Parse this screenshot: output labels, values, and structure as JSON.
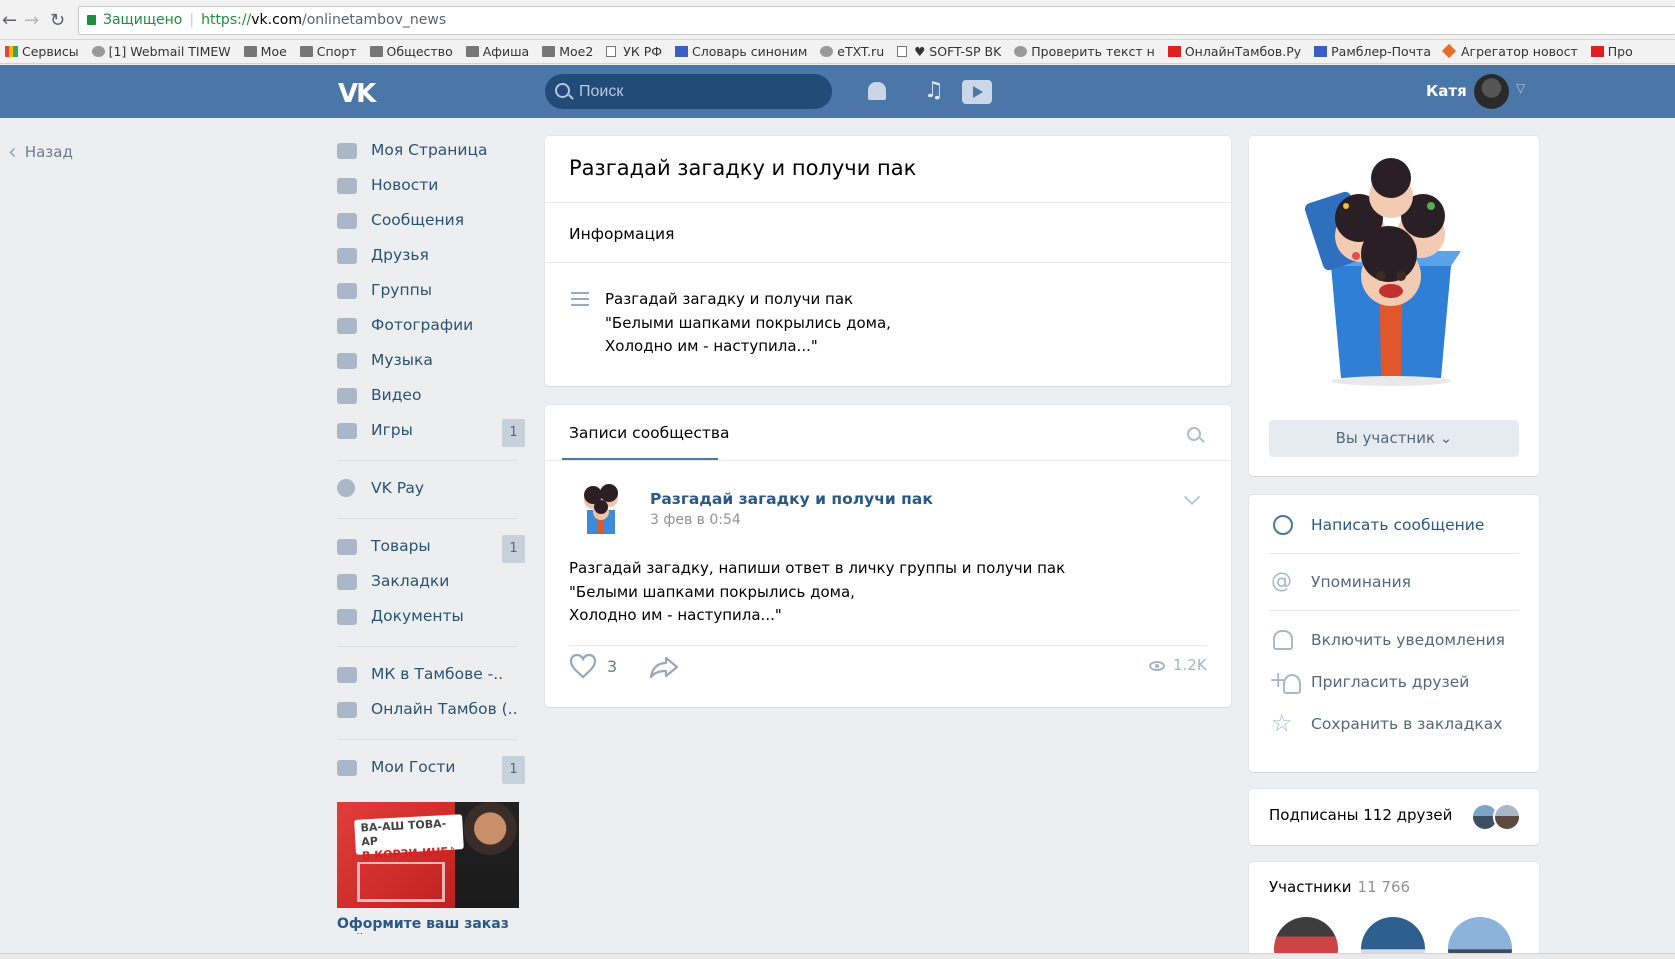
{
  "browser": {
    "secure_label": "Защищено",
    "url_scheme": "https://",
    "url_host": "vk.com",
    "url_path": "/onlinetambov_news",
    "bookmarks": [
      {
        "label": "Сервисы",
        "icon": "apps-icon"
      },
      {
        "label": "[1] Webmail TIMEW",
        "icon": "webmail-icon"
      },
      {
        "label": "Мое",
        "icon": "folder-icon"
      },
      {
        "label": "Спорт",
        "icon": "folder-icon"
      },
      {
        "label": "Общество",
        "icon": "folder-icon"
      },
      {
        "label": "Афиша",
        "icon": "folder-icon"
      },
      {
        "label": "Мое2",
        "icon": "folder-icon"
      },
      {
        "label": "УК РФ",
        "icon": "document-icon"
      },
      {
        "label": "Словарь синоним",
        "icon": "dictionary-icon"
      },
      {
        "label": "eTXT.ru",
        "icon": "etxt-icon"
      },
      {
        "label": "♥ SOFT-SP BK",
        "icon": "document-icon"
      },
      {
        "label": "Проверить текст н",
        "icon": "eye-icon"
      },
      {
        "label": "ОнлайнТамбов.Ру",
        "icon": "onlinetambov-icon"
      },
      {
        "label": "Рамблер-Почта",
        "icon": "mail-icon"
      },
      {
        "label": "Агрегатор новост",
        "icon": "aggregator-icon"
      },
      {
        "label": "Про",
        "icon": "copyright-icon"
      }
    ]
  },
  "header": {
    "logo": "VK",
    "search_placeholder": "Поиск",
    "user_name": "Катя",
    "music_glyph": "♫"
  },
  "back_label": "Назад",
  "menu": {
    "items": [
      {
        "label": "Моя Страница",
        "icon": "home-icon",
        "badge": ""
      },
      {
        "label": "Новости",
        "icon": "news-icon",
        "badge": ""
      },
      {
        "label": "Сообщения",
        "icon": "messages-icon",
        "badge": ""
      },
      {
        "label": "Друзья",
        "icon": "friends-icon",
        "badge": ""
      },
      {
        "label": "Группы",
        "icon": "groups-icon",
        "badge": ""
      },
      {
        "label": "Фотографии",
        "icon": "camera-icon",
        "badge": ""
      },
      {
        "label": "Музыка",
        "icon": "music-icon",
        "badge": ""
      },
      {
        "label": "Видео",
        "icon": "video-icon",
        "badge": ""
      },
      {
        "label": "Игры",
        "icon": "gamepad-icon",
        "badge": "1"
      }
    ],
    "vkpay": {
      "label": "VK Pay",
      "icon": "vkpay-icon"
    },
    "items2": [
      {
        "label": "Товары",
        "icon": "bag-icon",
        "badge": "1"
      },
      {
        "label": "Закладки",
        "icon": "star-icon",
        "badge": ""
      },
      {
        "label": "Документы",
        "icon": "document-icon",
        "badge": ""
      }
    ],
    "groups": [
      {
        "label": "МК в Тамбове -..",
        "icon": "groups-icon"
      },
      {
        "label": "Онлайн Тамбов (..",
        "icon": "groups-icon"
      }
    ],
    "guests": {
      "label": "Мои Гости",
      "icon": "apps-icon",
      "badge": "1"
    },
    "ad": {
      "tag_line1": "ВА-АШ ТОВА-АР",
      "tag_line2": "В КОРЗИ-ИНЕ♪",
      "caption": "Оформите ваш заказ сейчас"
    }
  },
  "info": {
    "title": "Разгадай загадку и получи пак",
    "section_label": "Информация",
    "text_lines": [
      "Разгадай загадку и получи пак",
      "\"Белыми шапками покрылись дома,",
      "Холодно им - наступила...\""
    ]
  },
  "wall": {
    "tab_label": "Записи сообщества",
    "post": {
      "author": "Разгадай загадку и получи пак",
      "date": "3 фев в 0:54",
      "text_lines": [
        "Разгадай загадку, напиши ответ в личку группы и получи пак",
        "\"Белыми шапками покрылись дома,",
        "Холодно им - наступила...\""
      ],
      "likes": "3",
      "views": "1.2K"
    }
  },
  "sidebar": {
    "member_button": "Вы участник ⌄",
    "actions": [
      {
        "label": "Написать сообщение",
        "icon": "message-bubble-icon",
        "primary": true
      },
      {
        "label": "Упоминания",
        "icon": "at-icon",
        "primary": false
      },
      {
        "label": "Включить уведомления",
        "icon": "bell-icon",
        "primary": false
      },
      {
        "label": "Пригласить друзей",
        "icon": "add-friend-icon",
        "primary": false
      },
      {
        "label": "Сохранить в закладках",
        "icon": "star-icon",
        "primary": false
      }
    ],
    "friends_subscribed": "Подписаны 112 друзей",
    "members_title": "Участники",
    "members_count": "11 766"
  },
  "colors": {
    "vk_blue": "#4a76a8",
    "link_blue": "#2a5885",
    "page_bg": "#edeef0"
  }
}
